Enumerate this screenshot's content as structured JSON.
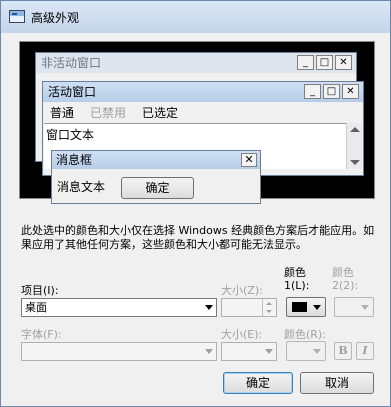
{
  "window": {
    "title": "高级外观"
  },
  "preview": {
    "inactive_title": "非活动窗口",
    "active_title": "活动窗口",
    "menu": [
      "普通",
      "已禁用",
      "已选定"
    ],
    "window_text": "窗口文本",
    "caption_buttons": {
      "minimize": "_",
      "maximize": "□",
      "close": "✕"
    },
    "messagebox": {
      "title": "消息框",
      "text": "消息文本",
      "ok": "确定"
    }
  },
  "description": "此处选中的颜色和大小仅在选择 Windows 经典颜色方案后才能应用。如果应用了其他任何方案，这些颜色和大小都可能无法显示。",
  "form": {
    "item_label": "项目(I):",
    "item_value": "桌面",
    "item_size_label": "大小(Z):",
    "color1_label": "颜色\n1(L):",
    "color2_label": "颜色\n2(2):",
    "font_label": "字体(F):",
    "font_size_label": "大小(E):",
    "font_color_label": "颜色(R):",
    "bold": "B",
    "italic": "I"
  },
  "buttons": {
    "ok": "确定",
    "cancel": "取消"
  },
  "colors": {
    "color1": "#000000",
    "titlebar": "#c4d5ea"
  }
}
